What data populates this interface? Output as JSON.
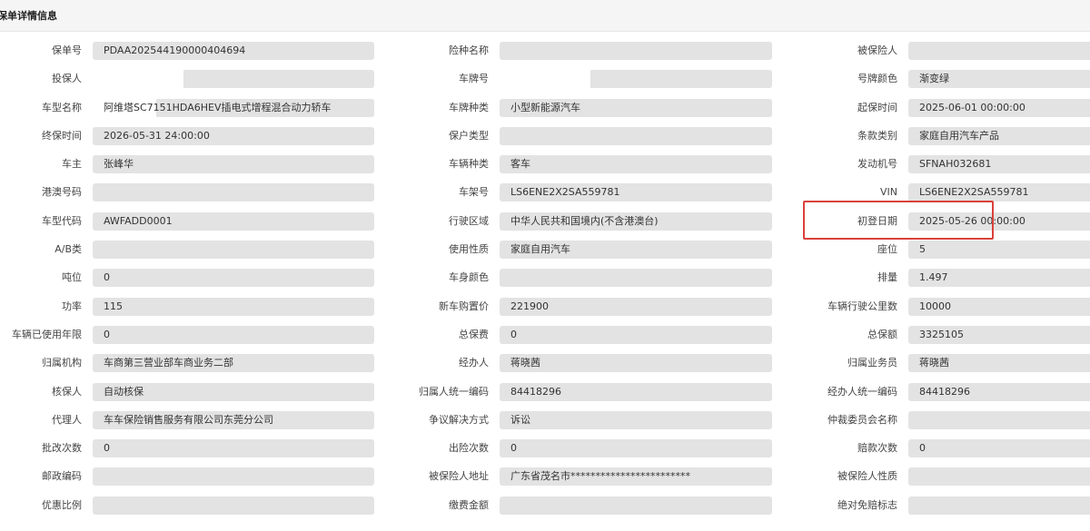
{
  "header": {
    "title": "保单详情信息"
  },
  "colors": {
    "highlight": "#d9413a",
    "field_bg": "#e3e3e3"
  },
  "rows": [
    [
      {
        "label": "保单号",
        "value": "PDAA202544190000404694"
      },
      {
        "label": "险种名称",
        "value": ""
      },
      {
        "label": "被保险人",
        "value": ""
      }
    ],
    [
      {
        "label": "投保人",
        "value": ""
      },
      {
        "label": "车牌号",
        "value": ""
      },
      {
        "label": "号牌颜色",
        "value": "渐变绿"
      }
    ],
    [
      {
        "label": "车型名称",
        "value": "阿维塔SC7151HDA6HEV插电式增程混合动力轿车"
      },
      {
        "label": "车牌种类",
        "value": "小型新能源汽车"
      },
      {
        "label": "起保时间",
        "value": "2025-06-01 00:00:00"
      }
    ],
    [
      {
        "label": "终保时间",
        "value": "2026-05-31 24:00:00"
      },
      {
        "label": "保户类型",
        "value": ""
      },
      {
        "label": "条款类别",
        "value": "家庭自用汽车产品"
      }
    ],
    [
      {
        "label": "车主",
        "value": "张峰华"
      },
      {
        "label": "车辆种类",
        "value": "客车"
      },
      {
        "label": "发动机号",
        "value": "SFNAH032681"
      }
    ],
    [
      {
        "label": "港澳号码",
        "value": ""
      },
      {
        "label": "车架号",
        "value": "LS6ENE2X2SA559781"
      },
      {
        "label": "VIN",
        "value": "LS6ENE2X2SA559781"
      }
    ],
    [
      {
        "label": "车型代码",
        "value": "AWFADD0001"
      },
      {
        "label": "行驶区域",
        "value": "中华人民共和国境内(不含港澳台)"
      },
      {
        "label": "初登日期",
        "value": "2025-05-26 00:00:00"
      }
    ],
    [
      {
        "label": "A/B类",
        "value": ""
      },
      {
        "label": "使用性质",
        "value": "家庭自用汽车"
      },
      {
        "label": "座位",
        "value": "5"
      }
    ],
    [
      {
        "label": "吨位",
        "value": "0"
      },
      {
        "label": "车身颜色",
        "value": ""
      },
      {
        "label": "排量",
        "value": "1.497"
      }
    ],
    [
      {
        "label": "功率",
        "value": "115"
      },
      {
        "label": "新车购置价",
        "value": "221900"
      },
      {
        "label": "车辆行驶公里数",
        "value": "10000"
      }
    ],
    [
      {
        "label": "车辆已使用年限",
        "value": "0"
      },
      {
        "label": "总保费",
        "value": "0"
      },
      {
        "label": "总保额",
        "value": "3325105"
      }
    ],
    [
      {
        "label": "归属机构",
        "value": "车商第三营业部车商业务二部"
      },
      {
        "label": "经办人",
        "value": "蒋晓茜"
      },
      {
        "label": "归属业务员",
        "value": "蒋晓茜"
      }
    ],
    [
      {
        "label": "核保人",
        "value": "自动核保"
      },
      {
        "label": "归属人统一编码",
        "value": "84418296"
      },
      {
        "label": "经办人统一编码",
        "value": "84418296"
      }
    ],
    [
      {
        "label": "代理人",
        "value": "车车保险销售服务有限公司东莞分公司"
      },
      {
        "label": "争议解决方式",
        "value": "诉讼"
      },
      {
        "label": "仲裁委员会名称",
        "value": ""
      }
    ],
    [
      {
        "label": "批改次数",
        "value": "0"
      },
      {
        "label": "出险次数",
        "value": "0"
      },
      {
        "label": "赔款次数",
        "value": "0"
      }
    ],
    [
      {
        "label": "邮政编码",
        "value": ""
      },
      {
        "label": "被保险人地址",
        "value": "广东省茂名市************************"
      },
      {
        "label": "被保险人性质",
        "value": ""
      }
    ],
    [
      {
        "label": "优惠比例",
        "value": ""
      },
      {
        "label": "缴费金额",
        "value": ""
      },
      {
        "label": "绝对免赔标志",
        "value": ""
      }
    ]
  ]
}
